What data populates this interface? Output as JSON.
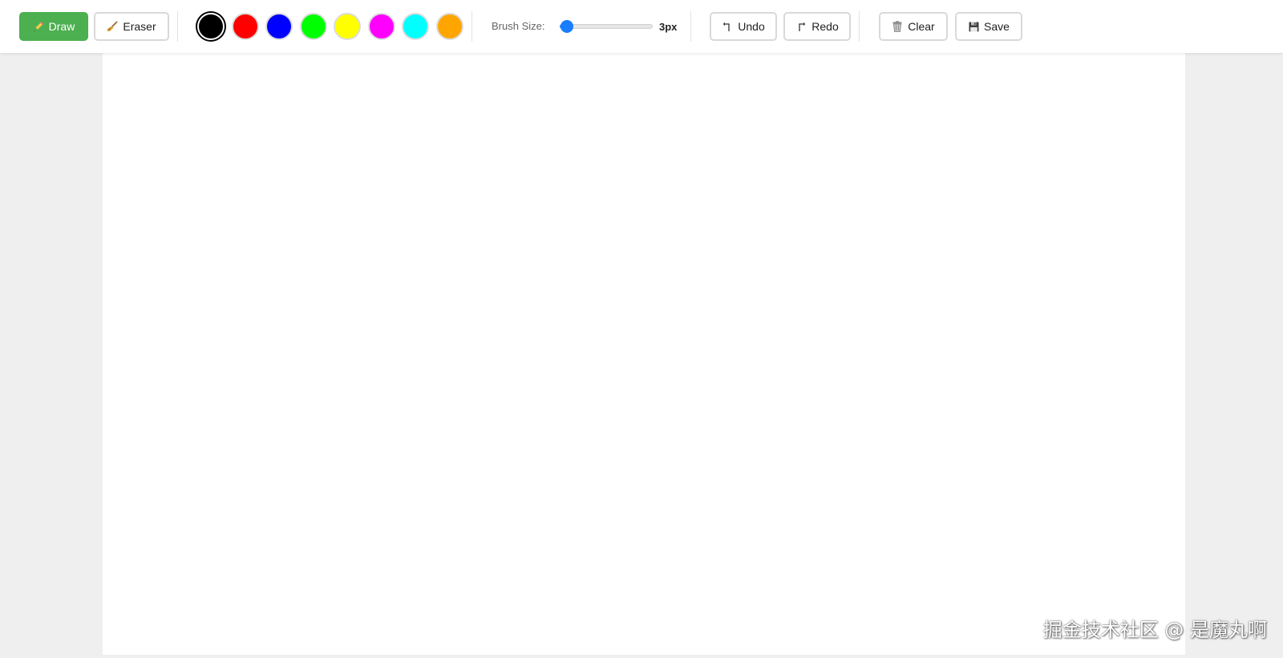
{
  "toolbar": {
    "draw_label": "Draw",
    "eraser_label": "Eraser",
    "colors": [
      "#000000",
      "#ff0000",
      "#0000ff",
      "#00ff00",
      "#ffff00",
      "#ff00ff",
      "#00ffff",
      "#ffa500"
    ],
    "selected_color": "#000000",
    "brush_label": "Brush Size:",
    "brush_value": "3px",
    "brush_size_fraction": 0.08,
    "undo_label": "Undo",
    "redo_label": "Redo",
    "clear_label": "Clear",
    "save_label": "Save",
    "active_tool": "draw",
    "accent_color": "#4caf50",
    "slider_color": "#2e8bff"
  },
  "icons": {
    "draw": "pencil-icon",
    "eraser": "broom-icon",
    "undo": "undo-icon",
    "redo": "redo-icon",
    "clear": "trash-icon",
    "save": "floppy-icon"
  },
  "watermark": "掘金技术社区 @ 是魔丸啊"
}
